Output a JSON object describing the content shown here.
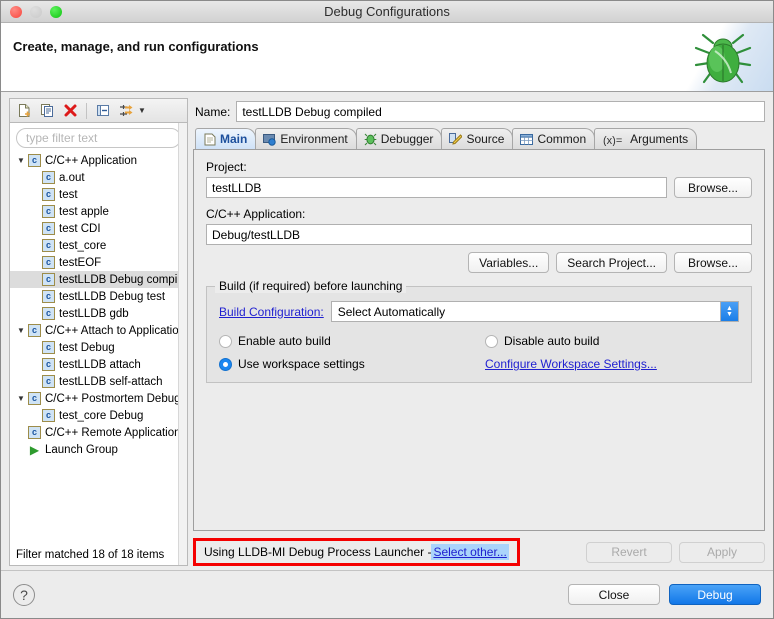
{
  "window": {
    "title": "Debug Configurations",
    "traffic_lights": [
      "close-button",
      "minimize-button",
      "maximize-button"
    ]
  },
  "banner": {
    "title": "Create, manage, and run configurations",
    "art_icon": "green-bug-icon"
  },
  "sidebar": {
    "toolbar": [
      {
        "name": "new-launch-configuration-button",
        "icon": "new-document-icon"
      },
      {
        "name": "duplicate-configuration-button",
        "icon": "copy-document-icon"
      },
      {
        "name": "delete-configuration-button",
        "icon": "red-x-icon"
      },
      {
        "name": "collapse-all-button",
        "icon": "collapse-all-icon"
      },
      {
        "name": "filter-launch-configurations-button",
        "icon": "filter-arrow-icon"
      }
    ],
    "filter": {
      "placeholder": "type filter text",
      "value": ""
    },
    "tree": [
      {
        "label": "C/C++ Application",
        "level": 0,
        "expanded": true,
        "icon": "c-file-icon",
        "selected": false
      },
      {
        "label": "a.out",
        "level": 1,
        "expanded": null,
        "icon": "c-file-icon",
        "selected": false
      },
      {
        "label": "test",
        "level": 1,
        "expanded": null,
        "icon": "c-file-icon",
        "selected": false
      },
      {
        "label": "test apple",
        "level": 1,
        "expanded": null,
        "icon": "c-file-icon",
        "selected": false
      },
      {
        "label": "test CDI",
        "level": 1,
        "expanded": null,
        "icon": "c-file-icon",
        "selected": false
      },
      {
        "label": "test_core",
        "level": 1,
        "expanded": null,
        "icon": "c-file-icon",
        "selected": false
      },
      {
        "label": "testEOF",
        "level": 1,
        "expanded": null,
        "icon": "c-file-icon",
        "selected": false
      },
      {
        "label": "testLLDB Debug compiled",
        "level": 1,
        "expanded": null,
        "icon": "c-file-icon",
        "selected": true
      },
      {
        "label": "testLLDB Debug test",
        "level": 1,
        "expanded": null,
        "icon": "c-file-icon",
        "selected": false
      },
      {
        "label": "testLLDB gdb",
        "level": 1,
        "expanded": null,
        "icon": "c-file-icon",
        "selected": false
      },
      {
        "label": "C/C++ Attach to Application",
        "level": 0,
        "expanded": true,
        "icon": "c-file-icon",
        "selected": false
      },
      {
        "label": "test Debug",
        "level": 1,
        "expanded": null,
        "icon": "c-file-icon",
        "selected": false
      },
      {
        "label": "testLLDB attach",
        "level": 1,
        "expanded": null,
        "icon": "c-file-icon",
        "selected": false
      },
      {
        "label": "testLLDB self-attach",
        "level": 1,
        "expanded": null,
        "icon": "c-file-icon",
        "selected": false
      },
      {
        "label": "C/C++ Postmortem Debugger",
        "level": 0,
        "expanded": true,
        "icon": "c-file-icon",
        "selected": false
      },
      {
        "label": "test_core Debug",
        "level": 1,
        "expanded": null,
        "icon": "c-file-icon",
        "selected": false
      },
      {
        "label": "C/C++ Remote Application",
        "level": 0,
        "expanded": null,
        "icon": "c-file-icon",
        "selected": false
      },
      {
        "label": "Launch Group",
        "level": 0,
        "expanded": null,
        "icon": "green-play-icon",
        "selected": false
      }
    ],
    "filter_status": "Filter matched 18 of 18 items"
  },
  "main": {
    "name_label": "Name:",
    "name_value": "testLLDB Debug compiled",
    "tabs": [
      {
        "label": "Main",
        "icon": "document-icon",
        "active": true
      },
      {
        "label": "Environment",
        "icon": "environment-icon",
        "active": false
      },
      {
        "label": "Debugger",
        "icon": "bug-icon",
        "active": false
      },
      {
        "label": "Source",
        "icon": "source-pencil-icon",
        "active": false
      },
      {
        "label": "Common",
        "icon": "table-icon",
        "active": false
      },
      {
        "label": "Arguments",
        "icon": "variable-icon",
        "active": false
      }
    ],
    "project_label": "Project:",
    "project_value": "testLLDB",
    "project_browse_label": "Browse...",
    "app_label": "C/C++ Application:",
    "app_value": "Debug/testLLDB",
    "app_buttons": [
      "Variables...",
      "Search Project...",
      "Browse..."
    ],
    "build_group": {
      "title": "Build (if required) before launching",
      "build_config_label": "Build Configuration:",
      "build_config_value": "Select Automatically",
      "radio_enable_auto_build": "Enable auto build",
      "radio_disable_auto_build": "Disable auto build",
      "radio_use_workspace_settings": "Use workspace settings",
      "configure_workspace_link": "Configure Workspace Settings...",
      "selected_radio": "use_workspace_settings"
    },
    "launcher": {
      "text_prefix": "Using LLDB-MI Debug Process Launcher - ",
      "select_other_link": "Select other...",
      "highlight_color": "#f40000"
    },
    "revert_label": "Revert",
    "apply_label": "Apply"
  },
  "footer": {
    "help_icon": "question-mark-icon",
    "close_label": "Close",
    "debug_label": "Debug",
    "accent_color": "#1277e8"
  }
}
